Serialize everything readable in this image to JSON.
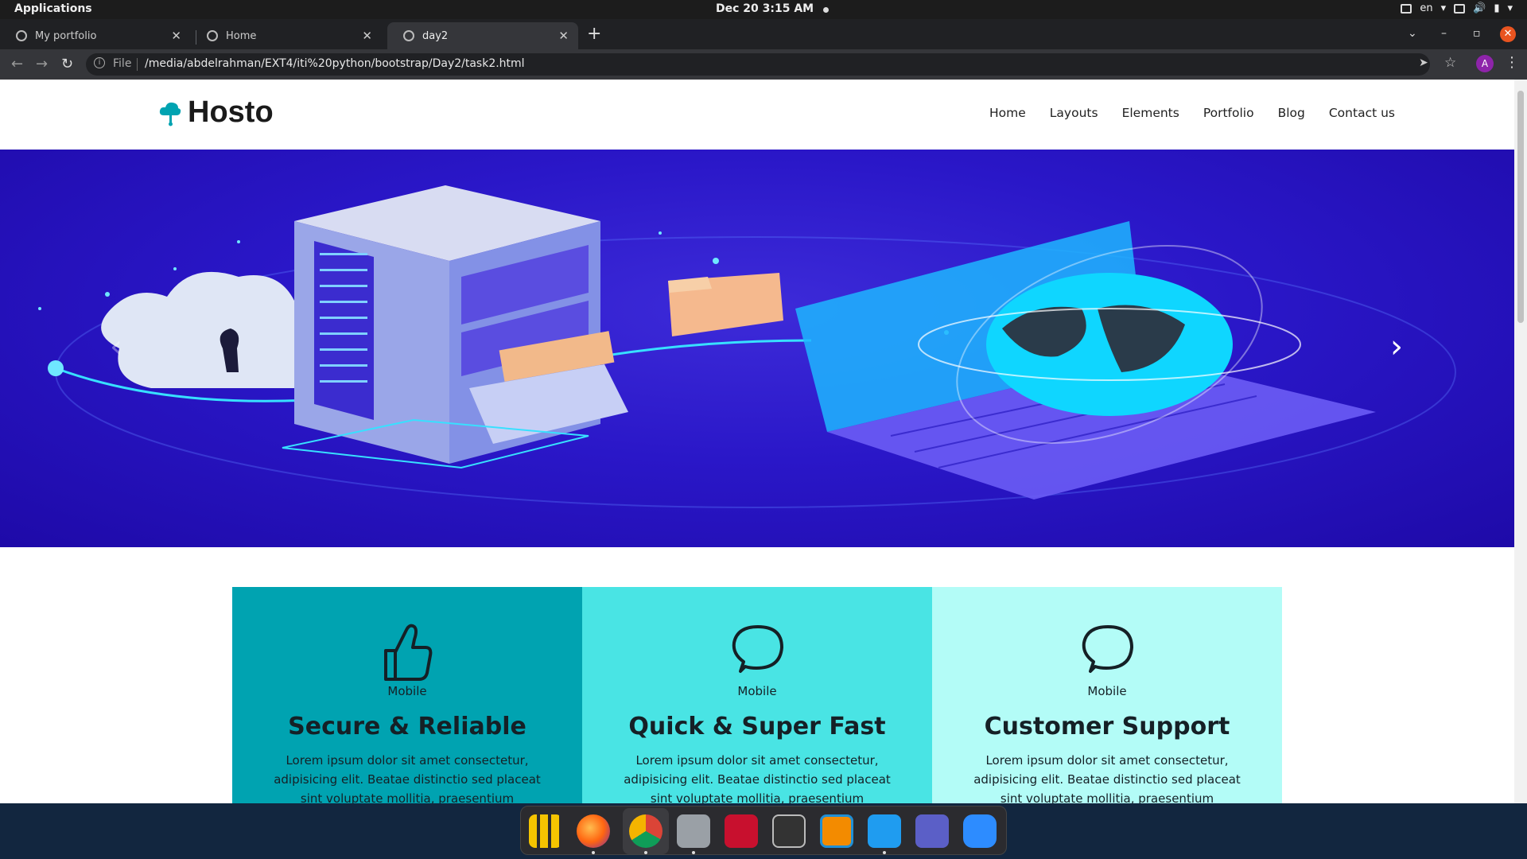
{
  "topbar": {
    "applications": "Applications",
    "clock": "Dec 20   3:15 AM",
    "lang": "en"
  },
  "tabs": [
    {
      "title": "My portfolio",
      "close": "✕"
    },
    {
      "title": "Home",
      "close": "✕"
    },
    {
      "title": "day2",
      "close": "✕"
    }
  ],
  "new_tab": "+",
  "address": {
    "scheme": "File",
    "url": "/media/abdelrahman/EXT4/iti%20python/bootstrap/Day2/task2.html",
    "avatar_letter": "A"
  },
  "site": {
    "brand": "Hosto",
    "nav": [
      "Home",
      "Layouts",
      "Elements",
      "Portfolio",
      "Blog",
      "Contact us"
    ]
  },
  "features": [
    {
      "icon": "thumbs-up-icon",
      "sub": "Mobile",
      "title": "Secure & Reliable",
      "text": "Lorem ipsum dolor sit amet consectetur, adipisicing elit. Beatae distinctio sed placeat sint voluptate mollitia, praesentium",
      "bg": "#00a3b1"
    },
    {
      "icon": "chat-bubble-icon",
      "sub": "Mobile",
      "title": "Quick & Super Fast",
      "text": "Lorem ipsum dolor sit amet consectetur, adipisicing elit. Beatae distinctio sed placeat sint voluptate mollitia, praesentium",
      "bg": "#49e4e4"
    },
    {
      "icon": "chat-bubble-icon",
      "sub": "Mobile",
      "title": "Customer Support",
      "text": "Lorem ipsum dolor sit amet consectetur, adipisicing elit. Beatae distinctio sed placeat sint voluptate mollitia, praesentium",
      "bg": "#b3fcf7"
    }
  ],
  "colors": {
    "hero": "#2a17c8",
    "accent": "#00a3b1",
    "dock_bg": "#2b2b2f"
  },
  "dock": [
    "app-grid-icon",
    "firefox-icon",
    "chrome-icon",
    "files-icon",
    "screenshot-app-icon",
    "terminal-icon",
    "vmware-icon",
    "vscode-icon",
    "teams-icon",
    "zoom-icon"
  ]
}
